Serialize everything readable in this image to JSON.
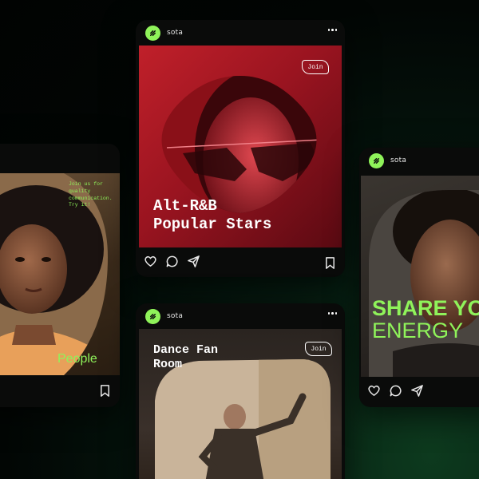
{
  "brand": {
    "name": "sota",
    "accent": "#8ff35a"
  },
  "cards": {
    "center_top": {
      "handle": "sota",
      "title_line1": "Alt-R&B",
      "title_line2": "Popular Stars",
      "join_label": "Join",
      "icons": [
        "heart-icon",
        "comment-icon",
        "share-icon",
        "bookmark-icon"
      ]
    },
    "center_bottom": {
      "handle": "sota",
      "title_line1": "Dance Fan",
      "title_line2": "Room",
      "join_label": "Join"
    },
    "left": {
      "tagline_line1": "Join us for",
      "tagline_line2": "quality",
      "tagline_line3": "communication.",
      "tagline_line4": "Try it!",
      "label": "People",
      "icons": [
        "bookmark-icon"
      ]
    },
    "right": {
      "handle": "sota",
      "headline_line1": "SHARE YO",
      "headline_line2": "ENERGY",
      "icons": [
        "heart-icon",
        "comment-icon",
        "share-icon"
      ]
    }
  }
}
